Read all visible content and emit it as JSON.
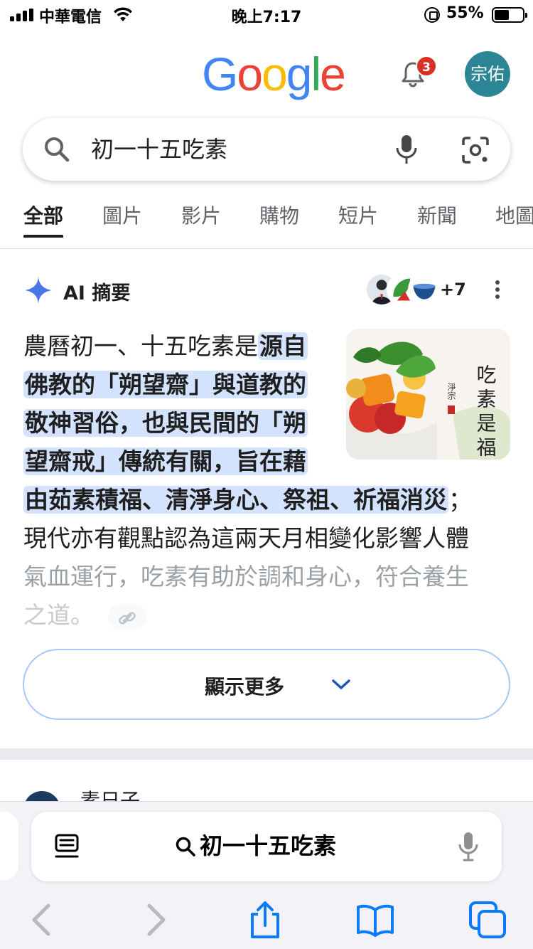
{
  "status_bar": {
    "carrier": "中華電信",
    "time": "晚上7:17",
    "battery": "55%"
  },
  "header": {
    "logo_letters": [
      "G",
      "o",
      "o",
      "g",
      "l",
      "e"
    ],
    "logo_colors": [
      "#4285F4",
      "#EA4335",
      "#FBBC05",
      "#4285F4",
      "#34A853",
      "#EA4335"
    ],
    "notification_count": "3",
    "avatar_text": "宗佑"
  },
  "search": {
    "query": "初一十五吃素"
  },
  "tabs": [
    "全部",
    "圖片",
    "影片",
    "購物",
    "短片",
    "新聞",
    "地圖"
  ],
  "ai_overview": {
    "title": "AI 摘要",
    "sources_more": "+7",
    "lines": [
      {
        "plain": "農曆初一、十五吃素是",
        "hl": "源自"
      },
      {
        "plain": "",
        "hl": "佛教的「朔望齋」與道教的"
      },
      {
        "plain": "",
        "hl": "敬神習俗，也與民間的「朔"
      },
      {
        "plain": "",
        "hl": "望齋戒」傳統有關，旨在藉"
      },
      {
        "plain_after": "；",
        "hl": "由茹素積福、清淨身心、祭祖、祈福消災"
      },
      {
        "plain": "現代亦有觀點認為這兩天月相變化影響人體"
      },
      {
        "plain": "氣血運行，吃素有助於調和身心，符合養生"
      },
      {
        "plain": "之道。"
      }
    ],
    "image_text": "吃素是福",
    "image_signature": "淨宗",
    "show_more": "顯示更多"
  },
  "next_result": {
    "title": "素日子"
  },
  "safari": {
    "address_text": "初一十五吃素"
  }
}
